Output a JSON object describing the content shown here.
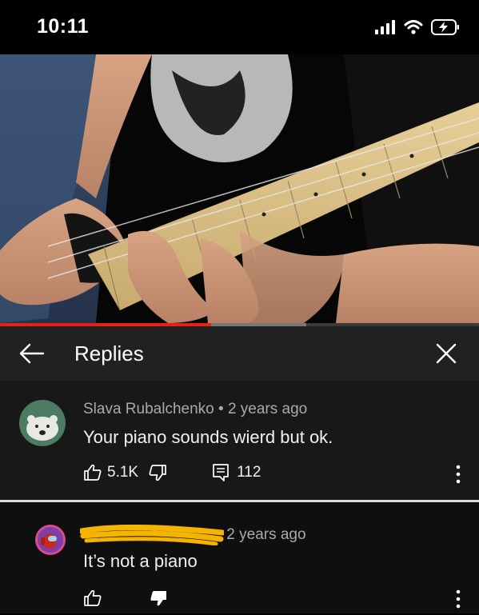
{
  "status_bar": {
    "time": "10:11"
  },
  "player": {
    "progress_percent": 44,
    "buffered_percent": 64
  },
  "header": {
    "title": "Replies"
  },
  "parent_comment": {
    "author": "Slava Rubalchenko",
    "separator": "•",
    "age": "2 years ago",
    "text": "Your piano sounds wierd but ok.",
    "likes": "5.1K",
    "replies": "112"
  },
  "reply_comment": {
    "age": "2 years ago",
    "text": "It’s not a piano"
  },
  "colors": {
    "accent": "#e62117",
    "scribble": "#f5b400",
    "panel": "#212121"
  }
}
